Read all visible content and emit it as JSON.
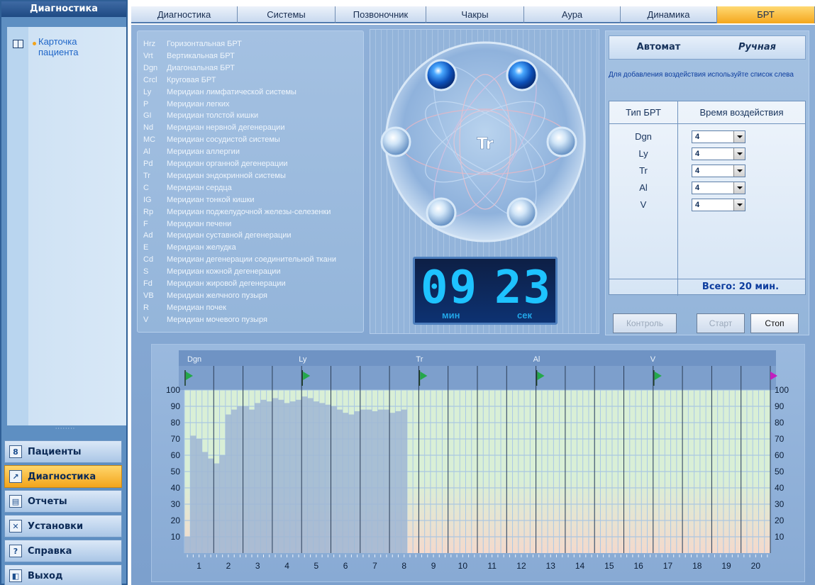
{
  "sidebar": {
    "header": "Диагностика",
    "tree_item": "Карточка пациента",
    "buttons": [
      {
        "label": "Пациенты",
        "icon": "patients-icon",
        "active": false
      },
      {
        "label": "Диагностика",
        "icon": "diagnostics-chart-icon",
        "active": true
      },
      {
        "label": "Отчеты",
        "icon": "printer-icon",
        "active": false
      },
      {
        "label": "Установки",
        "icon": "tools-icon",
        "active": false
      },
      {
        "label": "Справка",
        "icon": "help-book-icon",
        "active": false
      },
      {
        "label": "Выход",
        "icon": "exit-icon",
        "active": false
      }
    ]
  },
  "tabs": [
    {
      "label": "Диагностика",
      "active": false
    },
    {
      "label": "Системы",
      "active": false
    },
    {
      "label": "Позвоночник",
      "active": false
    },
    {
      "label": "Чакры",
      "active": false
    },
    {
      "label": "Аура",
      "active": false
    },
    {
      "label": "Динамика",
      "active": false
    },
    {
      "label": "БРТ",
      "active": true
    }
  ],
  "meridians": [
    {
      "code": "Hrz",
      "name": "Горизонтальная БРТ"
    },
    {
      "code": "Vrt",
      "name": "Вертикальная БРТ"
    },
    {
      "code": "Dgn",
      "name": "Диагональная БРТ"
    },
    {
      "code": "Crcl",
      "name": "Круговая БРТ"
    },
    {
      "code": "Ly",
      "name": "Меридиан лимфатической системы"
    },
    {
      "code": "P",
      "name": "Меридиан легких"
    },
    {
      "code": "GI",
      "name": "Меридиан толстой кишки"
    },
    {
      "code": "Nd",
      "name": "Меридиан нервной дегенерации"
    },
    {
      "code": "MC",
      "name": "Меридиан сосудистой системы"
    },
    {
      "code": "Al",
      "name": "Меридиан аллергии"
    },
    {
      "code": "Pd",
      "name": "Меридиан органной дегенерации"
    },
    {
      "code": "Tr",
      "name": "Меридиан эндокринной системы"
    },
    {
      "code": "C",
      "name": "Меридиан сердца"
    },
    {
      "code": "IG",
      "name": "Меридиан тонкой кишки"
    },
    {
      "code": "Rp",
      "name": "Меридиан поджелудочной железы-селезенки"
    },
    {
      "code": "F",
      "name": "Меридиан печени"
    },
    {
      "code": "Ad",
      "name": "Меридиан суставной дегенерации"
    },
    {
      "code": "E",
      "name": "Меридиан желудка"
    },
    {
      "code": "Cd",
      "name": "Меридиан дегенерации соединительной ткани"
    },
    {
      "code": "S",
      "name": "Меридиан кожной дегенерации"
    },
    {
      "code": "Fd",
      "name": "Меридиан жировой дегенерации"
    },
    {
      "code": "VB",
      "name": "Меридиан желчного пузыря"
    },
    {
      "code": "R",
      "name": "Меридиан почек"
    },
    {
      "code": "V",
      "name": "Меридиан мочевого пузыря"
    }
  ],
  "center": {
    "center_label": "Tr",
    "timer": {
      "minutes": "09",
      "seconds": "23",
      "min_label": "мин",
      "sec_label": "сек"
    }
  },
  "right": {
    "mode_auto": "Автомат",
    "mode_manual": "Ручная",
    "hint": "Для добавления воздействия используйте список слева",
    "col_type": "Тип БРТ",
    "col_time": "Время воздействия",
    "rows": [
      {
        "type": "Dgn",
        "time": "4"
      },
      {
        "type": "Ly",
        "time": "4"
      },
      {
        "type": "Tr",
        "time": "4"
      },
      {
        "type": "Al",
        "time": "4"
      },
      {
        "type": "V",
        "time": "4"
      }
    ],
    "total": "Всего:  20  мин.",
    "btn_control": "Контроль",
    "btn_start": "Старт",
    "btn_stop": "Стоп"
  },
  "chart_data": {
    "type": "bar",
    "segment_labels": [
      "Dgn",
      "Ly",
      "Tr",
      "Al",
      "V"
    ],
    "x_ticks": [
      "1",
      "2",
      "3",
      "4",
      "5",
      "6",
      "7",
      "8",
      "9",
      "10",
      "11",
      "12",
      "13",
      "14",
      "15",
      "16",
      "17",
      "18",
      "19",
      "20"
    ],
    "y_ticks": [
      "10",
      "20",
      "30",
      "40",
      "50",
      "60",
      "70",
      "80",
      "90",
      "100"
    ],
    "ylim": [
      0,
      100
    ],
    "values": [
      10,
      72,
      70,
      62,
      58,
      55,
      60,
      85,
      88,
      90,
      90,
      88,
      92,
      94,
      93,
      95,
      94,
      92,
      93,
      94,
      96,
      95,
      93,
      92,
      91,
      90,
      88,
      86,
      85,
      87,
      88,
      88,
      87,
      88,
      88,
      86,
      87,
      88
    ],
    "colors": {
      "bar": "#9fb6d3",
      "plot_bg": "#d9efd6",
      "plot_bg_bottom": "#f4d9cc",
      "flag": "#24a84a",
      "end_flag": "#c21fbe"
    }
  }
}
